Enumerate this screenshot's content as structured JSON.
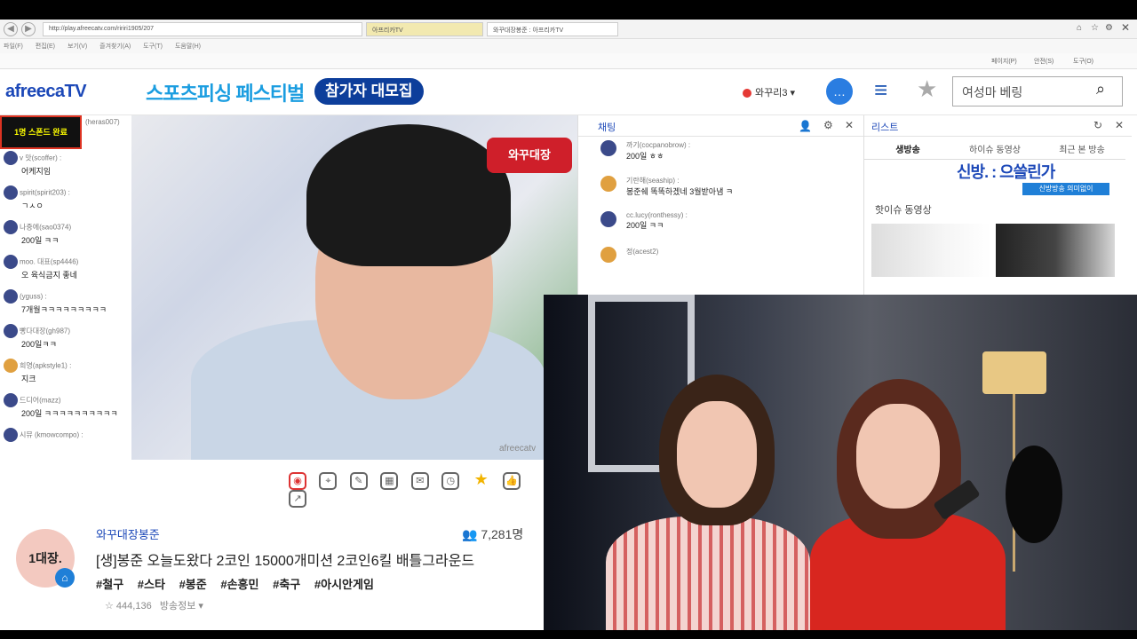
{
  "browser": {
    "url": "http://play.afreecatv.com/ririri1905/207",
    "tabs": [
      "아프리카TV",
      "와꾸대장봉준 : 아프리카TV"
    ],
    "menu": [
      "파일(F)",
      "편집(E)",
      "보기(V)",
      "즐겨찾기(A)",
      "도구(T)",
      "도움말(H)"
    ],
    "cmd": [
      "페이지(P)",
      "안전(S)",
      "도구(O)"
    ]
  },
  "header": {
    "logo": "afreecaTV",
    "banner_text": "스포츠피싱 페스티벌",
    "banner_button": "참가자 대모집",
    "login_text": "와꾸리3",
    "search_value": "여성마 베링"
  },
  "left_chat": {
    "items": [
      {
        "user": "(heras007)",
        "msg": ""
      },
      {
        "user": "v 맛(scoffer) :",
        "msg": "어케지임"
      },
      {
        "user": "spirit(spirit203) :",
        "msg": "ㄱㅅㅇ"
      },
      {
        "user": "나중에(sao0374)",
        "msg": "200일 ㅋㅋ"
      },
      {
        "user": "moo. 대표(sp4446)",
        "msg": "오 육식금지 좋네"
      },
      {
        "user": "(yguss) :",
        "msg": "7개월ㅋㅋㅋㅋㅋㅋㅋㅋㅋ"
      },
      {
        "user": "빵다대장(gh987)",
        "msg": "200일ㅋㅋ"
      },
      {
        "user": "희영(apkstyle1) :",
        "msg": "지크"
      },
      {
        "user": "드디어(mazz)",
        "msg": "200일 ㅋㅋㅋㅋㅋㅋㅋㅋㅋㅋ"
      },
      {
        "user": "시뮤 (kmowcompo) :",
        "msg": ""
      }
    ],
    "sign_text": "1명 스폰드 완료"
  },
  "video": {
    "overlay_logo": "와꾸대장",
    "watermark": "afreecatv"
  },
  "info": {
    "avatar_text": "1대장.",
    "bj_name": "와꾸대장봉준",
    "viewers": "7,281명",
    "title": "[생]봉준 오늘도왔다 2코인 15000개미션 2코인6킬 배틀그라운드",
    "tags": [
      "#철구",
      "#스타",
      "#봉준",
      "#손흥민",
      "#축구",
      "#아시안게임"
    ],
    "likes": "444,136",
    "broadcast_info": "방송정보"
  },
  "chat_panel": {
    "title": "채팅",
    "items": [
      {
        "user": "까기(cocpanobrow) :",
        "msg": "200일 ㅎㅎ"
      },
      {
        "user": "기란해(seaship) :",
        "msg": "봉준쉐 똑똑하겠네 3월받아냄 ㅋ"
      },
      {
        "user": "cc.lucy(ronthessy) :",
        "msg": "200일 ㅋㅋ"
      },
      {
        "user": "정(acest2)",
        "msg": ""
      }
    ]
  },
  "list_panel": {
    "title": "리스트",
    "tabs": [
      "생방송",
      "하이슈 동영상",
      "최근 본 방송"
    ],
    "promo": "신방. : 으쓸린가",
    "promo_sub": "신방방송 의미없이",
    "hot_label": "핫이슈 동영상"
  },
  "colors": {
    "brand_blue": "#1c48b8",
    "banner_blue": "#1a9de0",
    "accent_red": "#e53935"
  }
}
